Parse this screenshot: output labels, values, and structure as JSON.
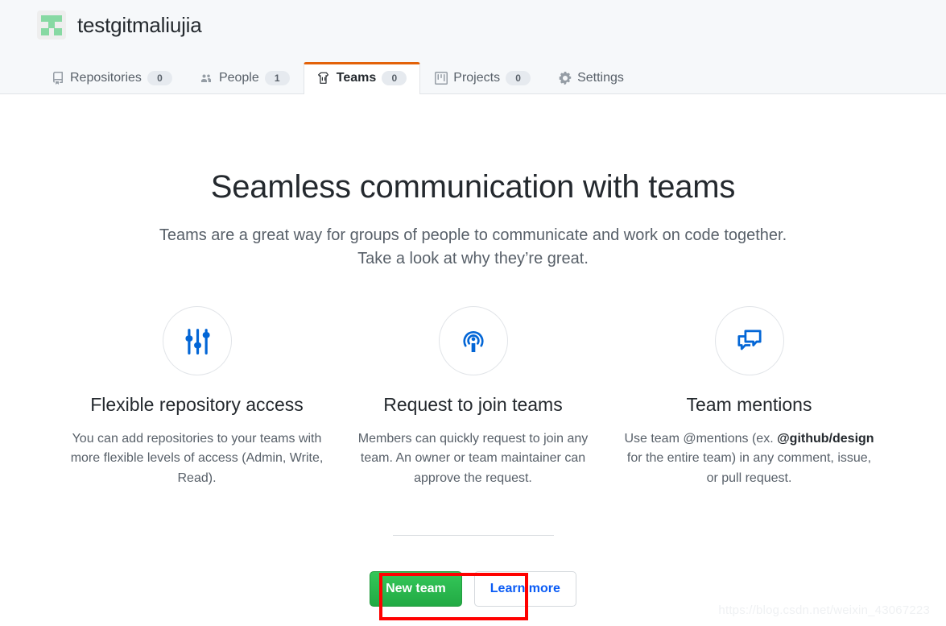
{
  "header": {
    "avatar_name": "org-identicon-avatar",
    "org_name": "testgitmaliujia",
    "tabs": [
      {
        "label": "Repositories",
        "count": "0",
        "icon": "repo-icon",
        "active": false
      },
      {
        "label": "People",
        "count": "1",
        "icon": "people-icon",
        "active": false
      },
      {
        "label": "Teams",
        "count": "0",
        "icon": "jersey-icon",
        "active": true
      },
      {
        "label": "Projects",
        "count": "0",
        "icon": "project-board-icon",
        "active": false
      },
      {
        "label": "Settings",
        "count": "",
        "icon": "gear-icon",
        "active": false
      }
    ]
  },
  "main": {
    "headline": "Seamless communication with teams",
    "lead_line1": "Teams are a great way for groups of people to communicate and work on code together.",
    "lead_line2": "Take a look at why they’re great.",
    "features": [
      {
        "icon": "sliders-icon",
        "title": "Flexible repository access",
        "body": "You can add repositories to your teams with more flexible levels of access (Admin, Write, Read)."
      },
      {
        "icon": "broadcast-icon",
        "title": "Request to join teams",
        "body": "Members can quickly request to join any team. An owner or team maintainer can approve the request."
      },
      {
        "icon": "comment-discussion-icon",
        "title": "Team mentions",
        "body_part1": "Use team @mentions (ex. ",
        "body_strong": "@github/design",
        "body_part2": " for the entire team) in any comment, issue, or pull request."
      }
    ],
    "actions": {
      "primary_label": "New team",
      "secondary_label": "Learn more"
    }
  },
  "annotation": {
    "shape": "red-rectangle-highlight",
    "color": "#ff0000",
    "target": "New team"
  },
  "watermark": "https://blog.csdn.net/weixin_43067223",
  "colors": {
    "accent_blue": "#0366d6",
    "active_tab_border": "#e36209",
    "primary_button": "#28a745",
    "header_bg": "#f6f8fa",
    "text_primary": "#24292e",
    "text_muted": "#586069"
  }
}
